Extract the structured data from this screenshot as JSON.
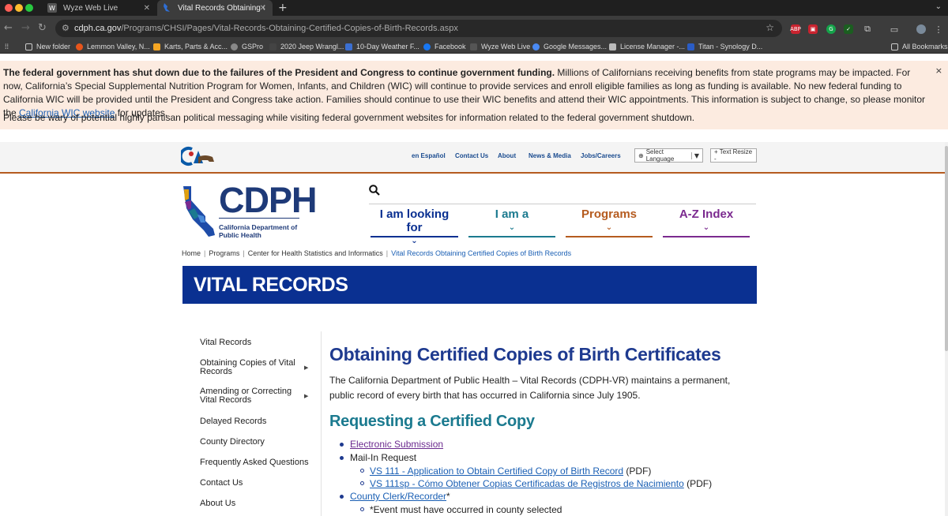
{
  "browser": {
    "tabs": [
      {
        "label": "Wyze Web Live",
        "favicon": "W"
      },
      {
        "label": "Vital Records Obtaining Certifi",
        "favicon": "cdph"
      }
    ],
    "new_tab": "+",
    "url_host": "cdph.ca.gov",
    "url_path": "/Programs/CHSI/Pages/Vital-Records-Obtaining-Certified-Copies-of-Birth-Records.aspx",
    "extensions": [
      "ABP",
      "cloud",
      "grammarly",
      "check",
      "puzzle",
      "media",
      "profile"
    ],
    "bookmarks": [
      "New folder",
      "Lemmon Valley, N...",
      "Karts, Parts & Acc...",
      "GSPro",
      "2020 Jeep Wrangl...",
      "10-Day Weather F...",
      "Facebook",
      "Wyze Web Live",
      "Google Messages...",
      "License Manager -...",
      "Titan - Synology D..."
    ],
    "all_bookmarks": "All Bookmarks"
  },
  "alert": {
    "lead": "The federal government has shut down due to the failures of the President and Congress to continue government funding.",
    "body": " Millions of Californians receiving benefits from state programs may be impacted. For now, California’s Special Supplemental Nutrition Program for Women, Infants, and Children (WIC) will continue to provide services and enroll eligible families as long as funding is available. No new federal funding to California WIC will be provided until the President and Congress take action. Families should continue to use their WIC benefits and attend their WIC appointments. This information is subject to change, so please monitor the ",
    "link": "California WIC website",
    "tail": " for updates.",
    "second": "Please be wary of potential highly partisan political messaging while visiting federal government websites for information related to the federal government shutdown.",
    "close": "×"
  },
  "utility": {
    "espanol": "en Español",
    "contact": "Contact Us",
    "about": "About",
    "news": "News & Media",
    "jobs": "Jobs/Careers",
    "language": "Select Language",
    "text_resize": "+ Text Resize -"
  },
  "logo": {
    "name": "CDPH",
    "sub1": "California Department of",
    "sub2": "Public Health"
  },
  "nav": [
    {
      "label": "I am looking for",
      "color": "#0a3091"
    },
    {
      "label": "I am a",
      "color": "#1b7a8f"
    },
    {
      "label": "Programs",
      "color": "#b55b1f"
    },
    {
      "label": "A-Z Index",
      "color": "#7b2a8f"
    }
  ],
  "breadcrumb": {
    "home": "Home",
    "programs": "Programs",
    "center": "Center for Health Statistics and Informatics",
    "current": "Vital Records Obtaining Certified Copies of Birth Records"
  },
  "hero": {
    "title": "VITAL RECORDS"
  },
  "sidebar": {
    "items": [
      {
        "label": "Vital Records"
      },
      {
        "label": "Obtaining Copies of Vital Records"
      },
      {
        "label": "Amending or Correcting Vital Records"
      },
      {
        "label": "Delayed Records"
      },
      {
        "label": "County Directory"
      },
      {
        "label": "Frequently Asked Questions"
      },
      {
        "label": "Contact Us"
      },
      {
        "label": "About Us"
      }
    ]
  },
  "main": {
    "title": "Obtaining Certified Copies of Birth Certificates",
    "intro": "The California Department of Public Health – Vital Records (CDPH-VR) maintains a permanent, public record of every birth that has occurred in California since July 1905.",
    "h2": "Requesting a Certified Copy",
    "list": {
      "electronic": "Electronic Submission",
      "mail_in": "Mail-In Request",
      "vs111": "VS 111 - Application to Obtain Certified Copy of  Birth Record",
      "vs111_suffix": " (PDF)",
      "vs111sp": "VS 111sp - Cómo Obtener Copias Certificadas de Registros de Nacimiento",
      "vs111sp_suffix": " (PDF)",
      "county": "County Clerk/Recorder",
      "county_suffix": "*",
      "note": "*Event must have occurred in county selected"
    }
  }
}
